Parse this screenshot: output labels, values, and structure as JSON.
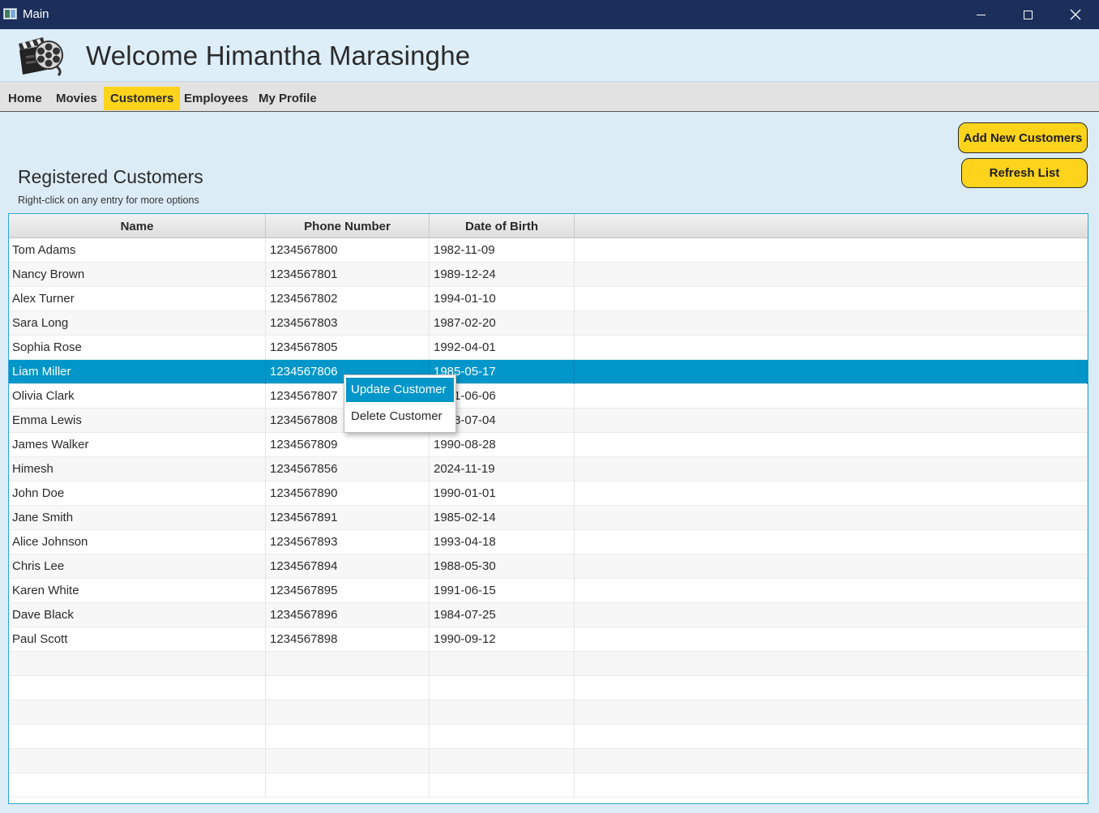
{
  "window": {
    "title": "Main"
  },
  "header": {
    "welcome": "Welcome Himantha Marasinghe"
  },
  "tabs": [
    {
      "label": "Home",
      "active": false
    },
    {
      "label": "Movies",
      "active": false
    },
    {
      "label": "Customers",
      "active": true
    },
    {
      "label": "Employees",
      "active": false
    },
    {
      "label": "My Profile",
      "active": false
    }
  ],
  "page": {
    "title": "Registered Customers",
    "hint": "Right-click on any entry for more options",
    "add_button": "Add New Customers",
    "refresh_button": "Refresh List"
  },
  "table": {
    "columns": [
      "Name",
      "Phone Number",
      "Date of Birth"
    ],
    "selected_index": 5,
    "rows": [
      [
        "Tom Adams",
        "1234567800",
        "1982-11-09"
      ],
      [
        "Nancy Brown",
        "1234567801",
        "1989-12-24"
      ],
      [
        "Alex Turner",
        "1234567802",
        "1994-01-10"
      ],
      [
        "Sara Long",
        "1234567803",
        "1987-02-20"
      ],
      [
        "Sophia Rose",
        "1234567805",
        "1992-04-01"
      ],
      [
        "Liam Miller",
        "1234567806",
        "1985-05-17"
      ],
      [
        "Olivia Clark",
        "1234567807",
        "1991-06-06"
      ],
      [
        "Emma Lewis",
        "1234567808",
        "1988-07-04"
      ],
      [
        "James Walker",
        "1234567809",
        "1990-08-28"
      ],
      [
        "Himesh",
        "1234567856",
        "2024-11-19"
      ],
      [
        "John Doe",
        "1234567890",
        "1990-01-01"
      ],
      [
        "Jane Smith",
        "1234567891",
        "1985-02-14"
      ],
      [
        "Alice Johnson",
        "1234567893",
        "1993-04-18"
      ],
      [
        "Chris Lee",
        "1234567894",
        "1988-05-30"
      ],
      [
        "Karen White",
        "1234567895",
        "1991-06-15"
      ],
      [
        "Dave Black",
        "1234567896",
        "1984-07-25"
      ],
      [
        "Paul Scott",
        "1234567898",
        "1990-09-12"
      ]
    ],
    "empty_rows": 6
  },
  "context_menu": {
    "items": [
      "Update Customer",
      "Delete Customer"
    ],
    "highlighted": 0
  },
  "colors": {
    "accent": "#fdd31b",
    "selection": "#0096c9",
    "titlebar": "#1c2e5a",
    "background": "#dcecf6"
  }
}
